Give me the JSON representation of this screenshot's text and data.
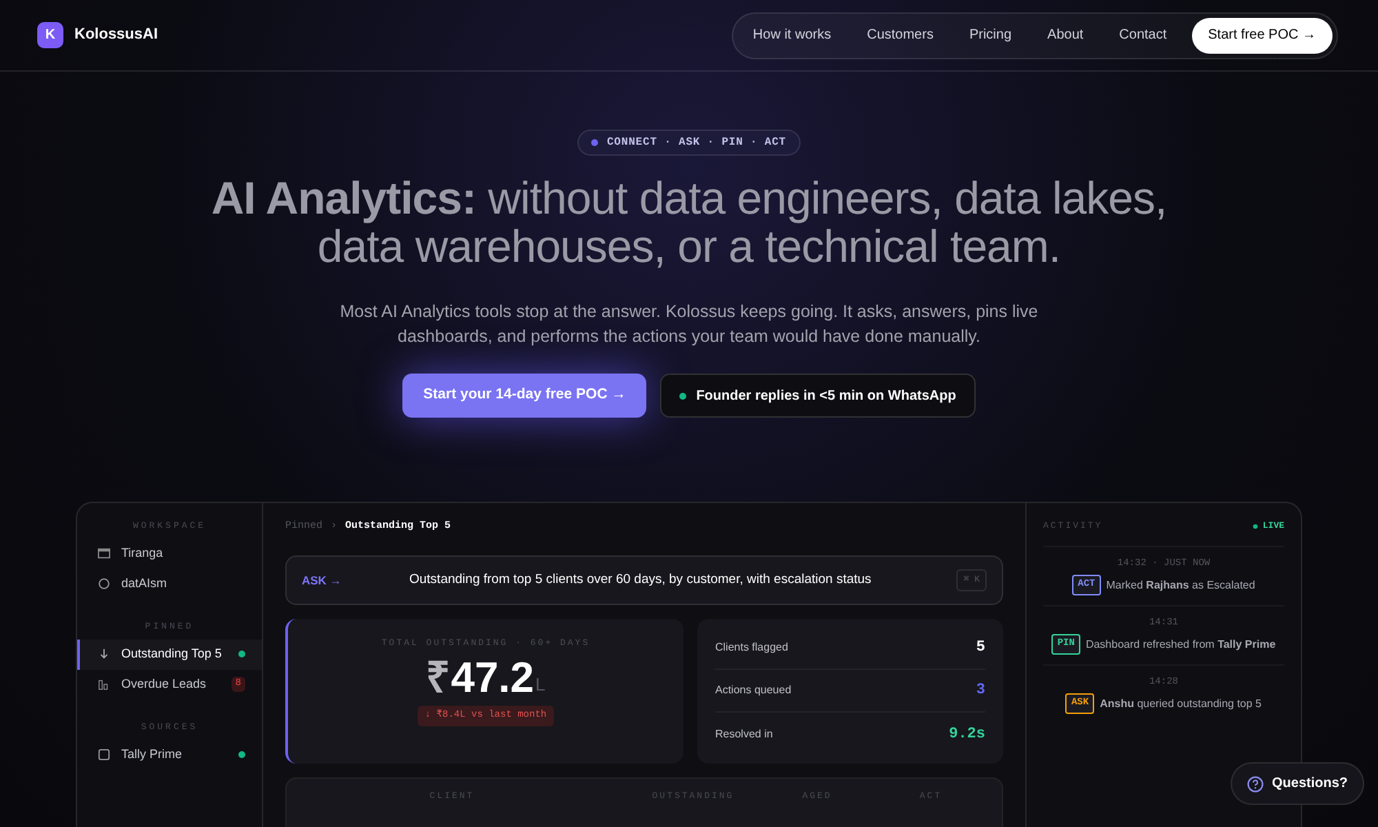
{
  "brand": {
    "logo_letter": "K",
    "name": "KolossusAI"
  },
  "nav": {
    "links": [
      "How it works",
      "Customers",
      "Pricing",
      "About",
      "Contact"
    ],
    "cta": {
      "label": "Start free POC",
      "arrow": "→"
    }
  },
  "hero": {
    "pill": "CONNECT · ASK · PIN · ACT",
    "headline": "**AI Analytics:** without data engineers, data lakes, data warehouses, or a technical team.",
    "paragraph": "Most AI Analytics tools stop at the answer. Kolossus keeps going. It asks, answers, pins live dashboards, and performs the actions your team would have done manually.",
    "primary": {
      "label": "Start your 14-day free POC",
      "arrow": "→"
    },
    "secondary": {
      "label": "Founder replies in <5 min on WhatsApp"
    }
  },
  "dashboard": {
    "sidebar": [
      {
        "heading": "WORKSPACE",
        "items": [
          {
            "label": "Tiranga",
            "kind": "window",
            "selected": false
          },
          {
            "label": "datAIsm",
            "kind": "circle",
            "selected": false
          }
        ]
      },
      {
        "heading": "PINNED",
        "items": [
          {
            "label": "Outstanding Top 5",
            "kind": "arrow",
            "selected": true,
            "color": "#10b981"
          },
          {
            "label": "Overdue Leads",
            "kind": "bars",
            "selected": false,
            "badge": "8"
          }
        ]
      },
      {
        "heading": "SOURCES",
        "items": [
          {
            "label": "Tally Prime",
            "kind": "square",
            "selected": false,
            "color": "#10b981"
          }
        ]
      }
    ],
    "breadcrumb": {
      "parent": "Pinned",
      "separator": "›",
      "current": "Outstanding Top 5"
    },
    "ask": {
      "label": "ASK",
      "arrow": "→",
      "query": "Outstanding from top 5 clients over 60 days, by customer, with escalation status",
      "shortcut": "⌘ K"
    },
    "kpi": {
      "label": "TOTAL OUTSTANDING · 60+ DAYS",
      "currency": "₹",
      "value": "47.2",
      "unit": "L",
      "delta": "↓ ₹8.4L vs last month"
    },
    "stats": [
      {
        "label": "Clients flagged",
        "value": "5",
        "color": "#ffffff"
      },
      {
        "label": "Actions queued",
        "value": "3",
        "color": "#6366f1"
      },
      {
        "label": "Resolved in",
        "value": "9.2s",
        "color": "#34d399"
      }
    ],
    "table": {
      "columns": [
        "CLIENT",
        "OUTSTANDING",
        "AGED",
        "ACT"
      ]
    },
    "activity": {
      "heading": "ACTIVITY",
      "live": "LIVE",
      "events": [
        {
          "time": "14:32 · JUST NOW",
          "tag": "ACT",
          "color": "#818cf8",
          "text": "Marked **Rajhans** as Escalated"
        },
        {
          "time": "14:31",
          "tag": "PIN",
          "color": "#34d399",
          "text": "Dashboard refreshed from **Tally Prime**"
        },
        {
          "time": "14:28",
          "tag": "ASK",
          "color": "#f59e0b",
          "text": "**Anshu** queried outstanding top 5"
        }
      ]
    }
  },
  "help": {
    "label": "Questions?"
  }
}
